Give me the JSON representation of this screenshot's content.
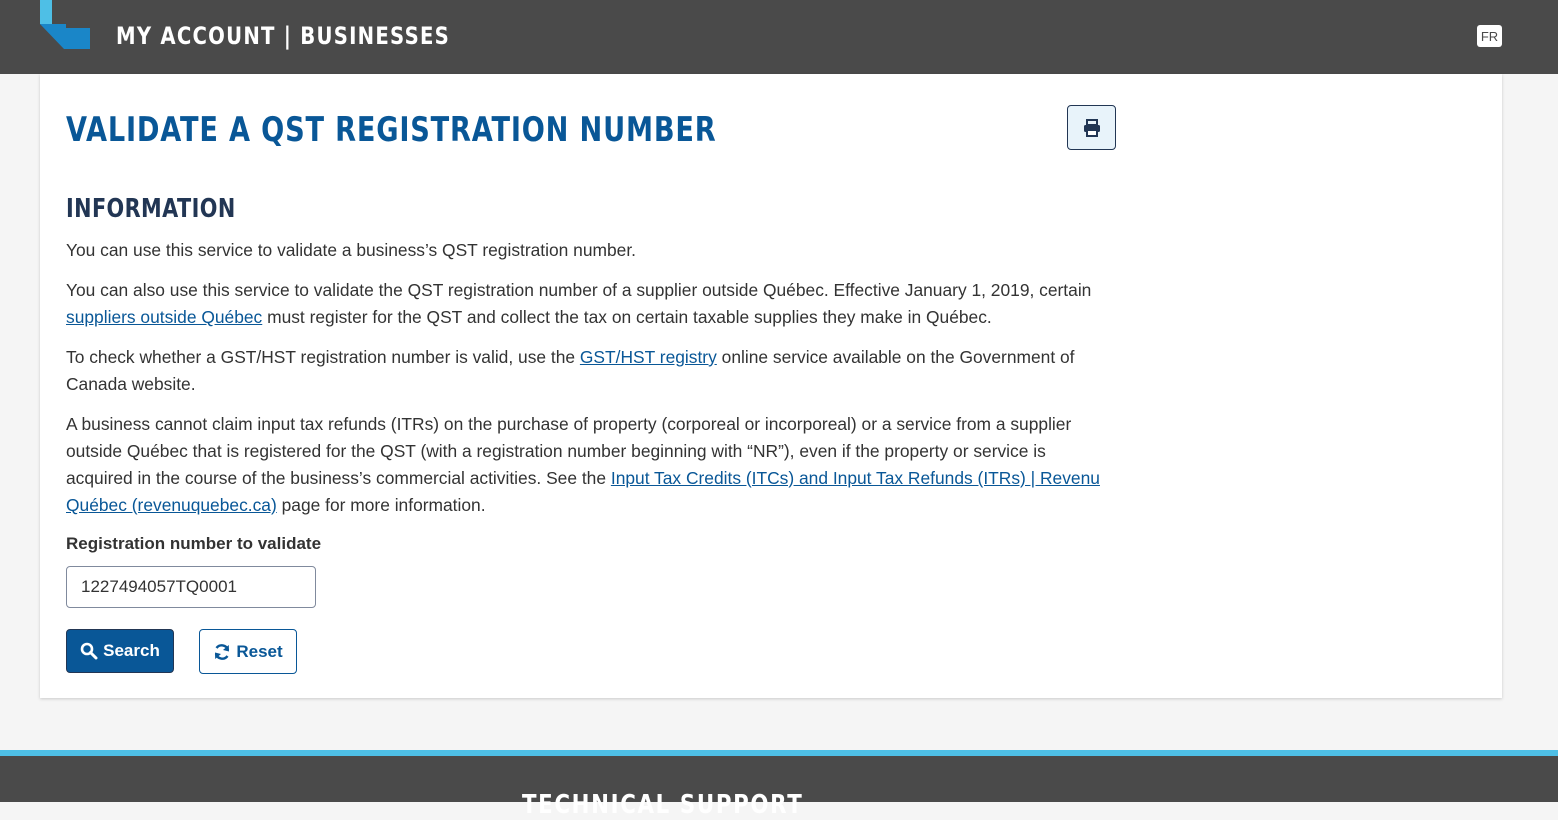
{
  "header": {
    "app_title": "MY ACCOUNT | BUSINESSES",
    "lang_toggle": "FR",
    "logo_colors": [
      "#4ebfe6",
      "#095797"
    ]
  },
  "main": {
    "page_title": "VALIDATE A QST REGISTRATION NUMBER",
    "print_icon": "print-icon",
    "section_title": "INFORMATION",
    "p1": "You can use this service to validate a business’s QST registration number.",
    "p2_before": "You can also use this service to validate the QST registration number of a supplier outside Québec. Effective January 1, 2019, certain ",
    "p2_link": "suppliers outside Québec",
    "p2_after": " must register for the QST and collect the tax on certain taxable supplies they make in Québec.",
    "p3_before": "To check whether a GST/HST registration number is valid, use the ",
    "p3_link": "GST/HST registry",
    "p3_after": " online service available on the Government of Canada website.",
    "p4_before": "A business cannot claim input tax refunds (ITRs) on the purchase of property (corporeal or incorporeal) or a service from a supplier outside Québec that is registered for the QST (with a registration number beginning with “NR”), even if the property or service is acquired in the course of the business’s commercial activities. See the ",
    "p4_link": "Input Tax Credits (ITCs) and Input Tax Refunds (ITRs) | Revenu Québec (revenuquebec.ca)",
    "p4_after": " page for more information."
  },
  "form": {
    "label": "Registration number to validate",
    "value": "1227494057TQ0001",
    "search_label": "Search",
    "search_icon": "search-icon",
    "reset_label": "Reset",
    "reset_icon": "refresh-icon"
  },
  "footer": {
    "title": "TECHNICAL SUPPORT"
  },
  "colors": {
    "header_bg": "#4a4a4a",
    "accent": "#095797",
    "dark_heading": "#223654",
    "footer_stripe": "#4ebfe6"
  }
}
